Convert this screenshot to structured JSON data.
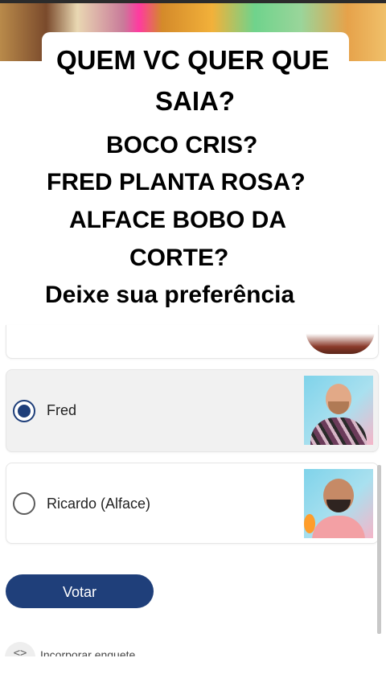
{
  "headline": {
    "lines": [
      "QUEM VC QUER QUE",
      "SAIA?",
      "BOCO CRIS?",
      "FRED PLANTA ROSA?",
      "ALFACE BOBO DA",
      "CORTE?",
      "Deixe sua preferência"
    ]
  },
  "poll": {
    "options": [
      {
        "label": "Fred",
        "selected": true
      },
      {
        "label": "Ricardo (Alface)",
        "selected": false
      }
    ],
    "vote_label": "Votar",
    "embed_label": "Incorporar enquete",
    "embed_icon": "<>"
  },
  "colors": {
    "accent": "#1f3f7a",
    "selected_row": "#f1f1f1"
  }
}
